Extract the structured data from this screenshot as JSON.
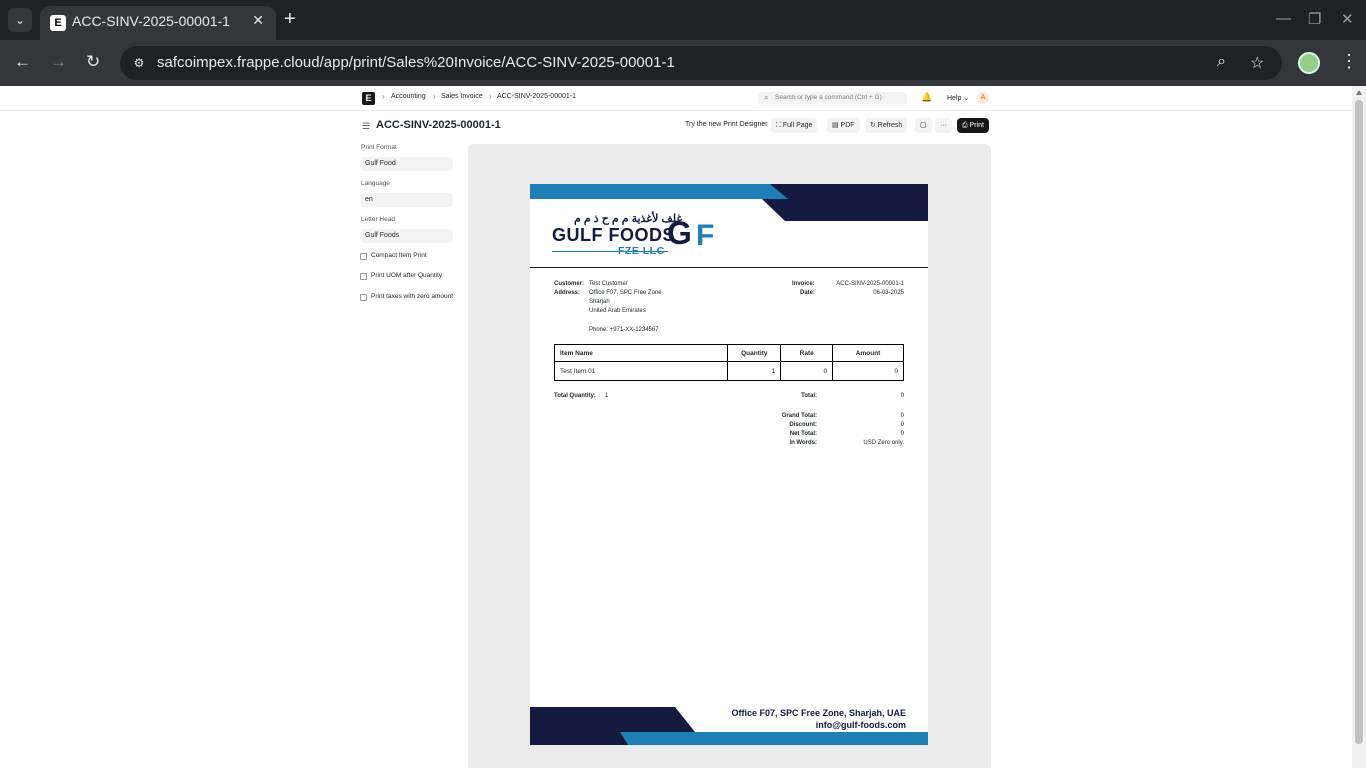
{
  "browser": {
    "tab_title": "ACC-SINV-2025-00001-1",
    "tab_favicon": "E",
    "url": "safcoimpex.frappe.cloud/app/print/Sales%20Invoice/ACC-SINV-2025-00001-1",
    "icons": {
      "tab_dropdown": "⌄",
      "tab_close": "✕",
      "new_tab": "+",
      "back": "←",
      "forward": "→",
      "reload": "↻",
      "site_info": "⚙",
      "zoom": "⌕",
      "bookmark": "☆",
      "menu": "⋮",
      "minimize": "—",
      "restore": "❐",
      "close": "✕"
    }
  },
  "app": {
    "logo": "E",
    "breadcrumbs": [
      "Accounting",
      "Sales Invoice",
      "ACC-SINV-2025-00001-1"
    ],
    "breadcrumb_sep": "›",
    "search_placeholder": "Search or type a command (Ctrl + G)",
    "help_label": "Help ⌄",
    "user_initial": "A",
    "bell": "🔔",
    "search_icon": "⌕"
  },
  "toolbar": {
    "menu_icon": "☰",
    "title": "ACC-SINV-2025-00001-1",
    "try_designer": "Try the new Print Designer",
    "full_page": "⛶ Full Page",
    "pdf": "▤ PDF",
    "refresh": "↻ Refresh",
    "doc_icon": "▢",
    "more": "···",
    "print": "⎙ Print"
  },
  "sidebar": {
    "print_format_label": "Print Format",
    "print_format_value": "Gulf Food",
    "language_label": "Language",
    "language_value": "en",
    "letter_head_label": "Letter Head",
    "letter_head_value": "Gulf Foods",
    "checkboxes": [
      "Compact Item Print",
      "Print UOM after Quantity",
      "Print taxes with zero amount"
    ]
  },
  "letterhead": {
    "arabic_name": "غلف لأغذية م م ح ذ م م",
    "name": "GULF FOODS",
    "subtitle": "FZE LLC",
    "logo_g": "G",
    "logo_f": "F",
    "footer_address": "Office F07, SPC Free Zone, Sharjah, UAE",
    "footer_email": "info@gulf-foods.com",
    "colors": {
      "navy": "#141a40",
      "blue": "#1d7fb4"
    }
  },
  "invoice": {
    "customer_label": "Customer:",
    "customer": "Test Customer",
    "address_label": "Address:",
    "address_lines": [
      "Office F07, SPC Free Zone",
      "Sharjah",
      "United Arab Emirates"
    ],
    "phone": "Phone: +971-XX-1234567",
    "invoice_label": "Invoice:",
    "invoice_no": "ACC-SINV-2025-00001-1",
    "date_label": "Date:",
    "date": "06-03-2025",
    "columns": [
      "Item Name",
      "Quantity",
      "Rate",
      "Amount"
    ],
    "items": [
      {
        "name": "Test Item 01",
        "qty": "1",
        "rate": "0",
        "amount": "0"
      }
    ],
    "total_qty_label": "Total Quantity:",
    "total_qty": "1",
    "total_label": "Total:",
    "total": "0",
    "grand_total_label": "Grand Total:",
    "grand_total": "0",
    "discount_label": "Discount:",
    "discount": "0",
    "net_total_label": "Net Total:",
    "net_total": "0",
    "in_words_label": "In Words:",
    "in_words": "USD Zero only."
  }
}
